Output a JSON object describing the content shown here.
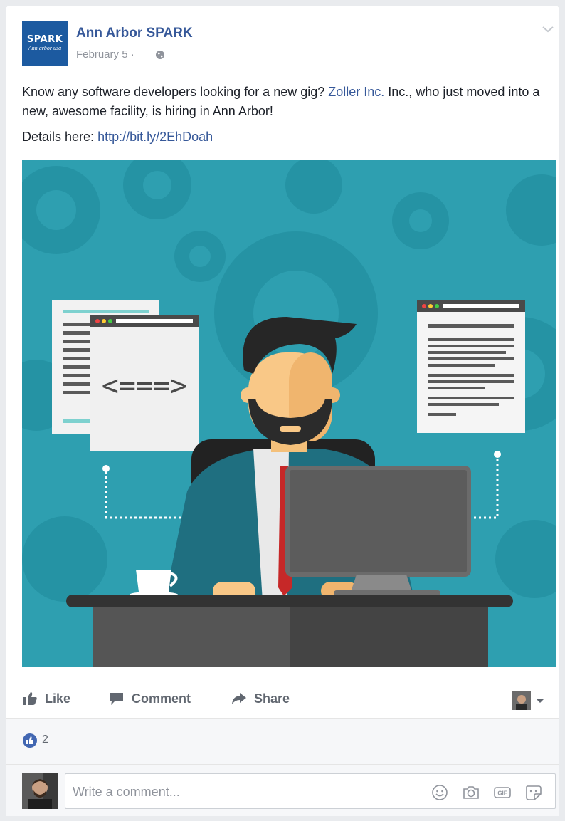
{
  "page": {
    "name": "Ann Arbor SPARK",
    "logo_line1": "SPARK",
    "logo_line2": "Ann arbor usa",
    "date": "February 5 ·"
  },
  "post": {
    "text_before_link": "Know any software developers looking for a new gig? ",
    "mention": "Zoller Inc.",
    "text_after_link": " Inc., who just moved into a new, awesome facility, is hiring in Ann Arbor!",
    "details_label": "Details here: ",
    "details_url": "http://bit.ly/2EhDoah"
  },
  "illustration": {
    "code_symbol": "<===>",
    "colors": {
      "background": "#2e9fb0",
      "gear": "#2593a4",
      "suit": "#1f6f80",
      "monitor": "#5c5c5c",
      "desk": "#333333"
    }
  },
  "actions": {
    "like": "Like",
    "comment": "Comment",
    "share": "Share"
  },
  "reactions": {
    "like_count": "2"
  },
  "comment_box": {
    "placeholder": "Write a comment..."
  },
  "icons": [
    "globe-icon",
    "chevron-down-icon",
    "like-icon",
    "comment-icon",
    "share-icon",
    "emoji-icon",
    "camera-icon",
    "gif-icon",
    "sticker-icon"
  ],
  "colors": {
    "link": "#365899",
    "facebook_blue": "#4267b2",
    "muted": "#90949c",
    "action_text": "#616770"
  }
}
